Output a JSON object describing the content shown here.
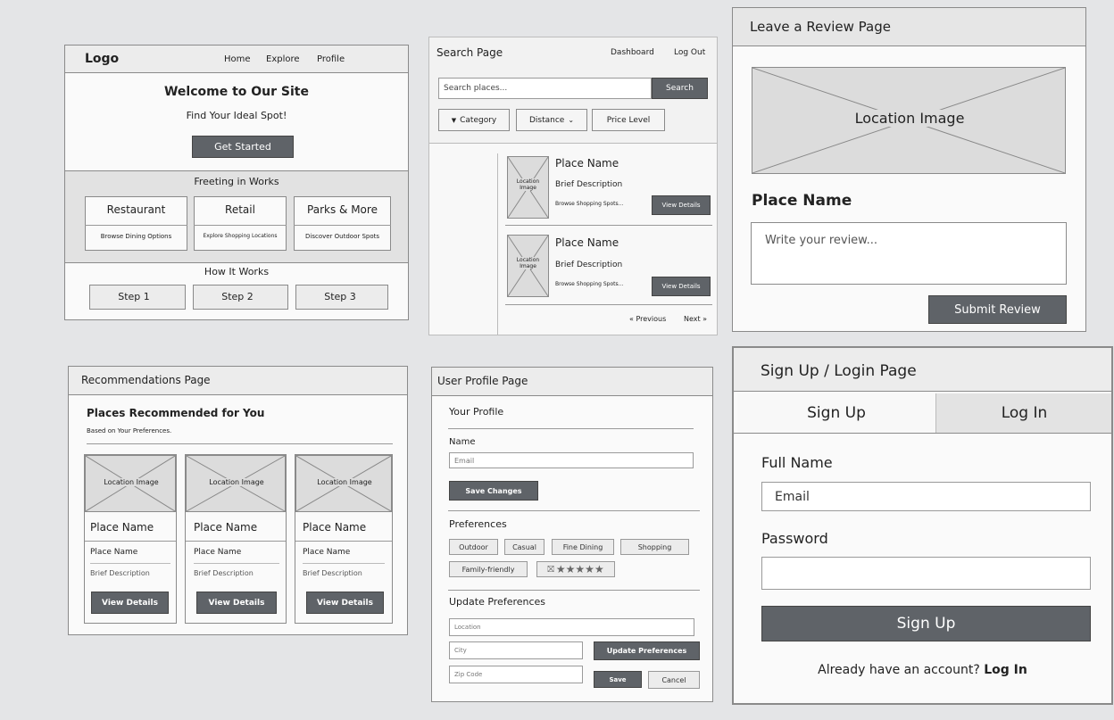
{
  "home": {
    "logo": "Logo",
    "nav": [
      "Home",
      "Explore",
      "Profile"
    ],
    "hero_title": "Welcome to Our Site",
    "hero_subtitle": "Find Your Ideal Spot!",
    "cta": "Get Started",
    "featured_title": "Freeting in Works",
    "categories": [
      {
        "title": "Restaurant",
        "desc": "Browse Dining Options"
      },
      {
        "title": "Retail",
        "desc": "Explore Shopping Locations"
      },
      {
        "title": "Parks & More",
        "desc": "Discover Outdoor Spots"
      }
    ],
    "how_title": "How It Works",
    "steps": [
      "Step 1",
      "Step 2",
      "Step 3"
    ]
  },
  "search": {
    "title": "Search Page",
    "nav": [
      "Dashboard",
      "Log Out"
    ],
    "placeholder": "Search places...",
    "search_button": "Search",
    "filters": [
      "Category",
      "Distance",
      "Price Level"
    ],
    "results": [
      {
        "image": "Location Image",
        "name": "Place Name",
        "desc": "Brief Description",
        "sub": "Browse Shopping Spots...",
        "button": "View Details"
      },
      {
        "image": "Location Image",
        "name": "Place Name",
        "desc": "Brief Description",
        "sub": "Browse Shopping Spots...",
        "button": "View Details"
      }
    ],
    "prev": "Previous",
    "next": "Next"
  },
  "review": {
    "title": "Leave a Review Page",
    "image": "Location Image",
    "place_name": "Place Name",
    "placeholder": "Write your review...",
    "submit": "Submit Review"
  },
  "recommendations": {
    "title": "Recommendations Page",
    "heading": "Places Recommended for You",
    "subheading": "Based on Your Preferences.",
    "cards": [
      {
        "image": "Location Image",
        "title": "Place Name",
        "name": "Place Name",
        "desc": "Brief Description",
        "button": "View Details"
      },
      {
        "image": "Location Image",
        "title": "Place Name",
        "name": "Place Name",
        "desc": "Brief Description",
        "button": "View Details"
      },
      {
        "image": "Location Image",
        "title": "Place Name",
        "name": "Place Name",
        "desc": "Brief Description",
        "button": "View Details"
      }
    ]
  },
  "profile": {
    "title": "User Profile Page",
    "section": "Your Profile",
    "name_label": "Name",
    "email_placeholder": "Email",
    "save_changes": "Save Changes",
    "preferences_label": "Preferences",
    "tags": [
      "Outdoor",
      "Casual",
      "Fine Dining",
      "Shopping",
      "Family-friendly"
    ],
    "rating_icon": "⛝",
    "rating": "★★★★★",
    "update_label": "Update Preferences",
    "location_placeholder": "Location",
    "city_placeholder": "City",
    "zip_placeholder": "Zip Code",
    "update_button": "Update Preferences",
    "save": "Save",
    "cancel": "Cancel"
  },
  "signup": {
    "title": "Sign Up / Login Page",
    "tab_signup": "Sign Up",
    "tab_login": "Log In",
    "fullname_label": "Full Name",
    "email_placeholder": "Email",
    "password_label": "Password",
    "submit": "Sign Up",
    "footer_text": "Already have an account?",
    "footer_link": "Log In"
  }
}
